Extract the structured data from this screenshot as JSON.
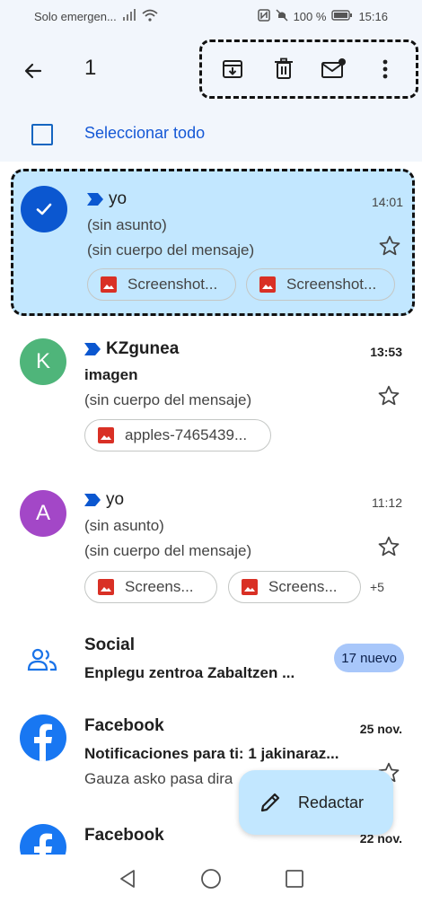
{
  "status": {
    "carrier": "Solo emergen...",
    "battery": "100 %",
    "time": "15:16"
  },
  "topbar": {
    "selected_count": "1",
    "icons": [
      "archive-icon",
      "trash-icon",
      "mark-unread-icon",
      "more-vert-icon"
    ]
  },
  "select_all": {
    "label": "Seleccionar todo"
  },
  "emails": [
    {
      "sender": "yo",
      "time": "14:01",
      "subject": "(sin asunto)",
      "snippet": "(sin cuerpo del mensaje)",
      "attachments": [
        "Screenshot...",
        "Screenshot..."
      ]
    },
    {
      "avatar_letter": "K",
      "avatar_color": "#4fb57a",
      "sender": "KZgunea",
      "time": "13:53",
      "subject": "imagen",
      "snippet": "(sin cuerpo del mensaje)",
      "attachments": [
        "apples-7465439..."
      ]
    },
    {
      "avatar_letter": "A",
      "avatar_color": "#a347c7",
      "sender": "yo",
      "time": "11:12",
      "subject": "(sin asunto)",
      "snippet": "(sin cuerpo del mensaje)",
      "attachments": [
        "Screens...",
        "Screens..."
      ],
      "more_attachments": "+5"
    }
  ],
  "social": {
    "title": "Social",
    "snippet": "Enplegu zentroa Zabaltzen ...",
    "badge": "17 nuevo"
  },
  "facebook1": {
    "sender": "Facebook",
    "date": "25 nov.",
    "subject": "Notificaciones para ti: 1 jakinaraz...",
    "snippet": "Gauza asko pasa dira"
  },
  "facebook2": {
    "sender": "Facebook",
    "date": "22 nov."
  },
  "compose": {
    "label": "Redactar"
  },
  "colors": {
    "accent": "#0b57d0",
    "selected_bg": "#c2e7ff",
    "chip_icon": "#d93025",
    "facebook": "#1877f2"
  }
}
